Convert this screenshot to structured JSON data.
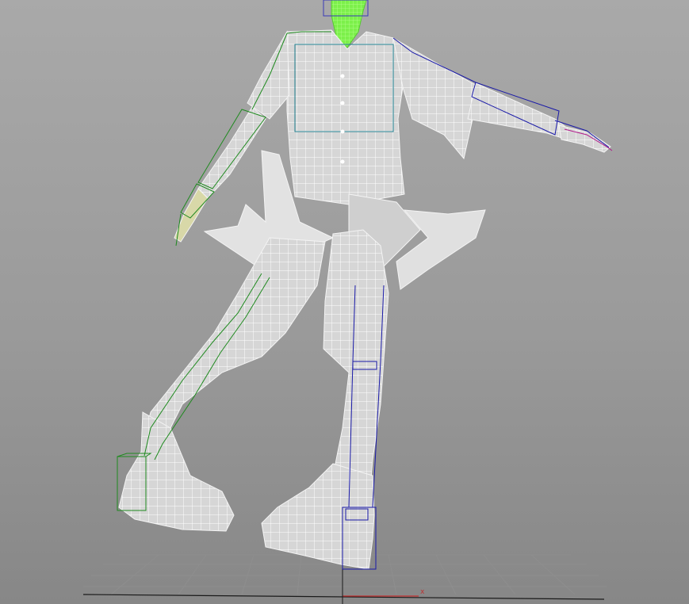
{
  "viewport": {
    "background_top": "#a9a9a9",
    "background_bottom": "#878787",
    "grid_color": "#8e8e8e",
    "axis_label_x": "x"
  },
  "colors": {
    "mesh_fill": "#d8d8d8",
    "mesh_wire": "#ffffff",
    "selected_head": "#7cf04a",
    "bone_green": "#1f8a1f",
    "bone_blue": "#1a1aa8",
    "bone_teal": "#1a7a8a",
    "axis_x": "#c03030",
    "axis_y": "#1a1a1a"
  }
}
